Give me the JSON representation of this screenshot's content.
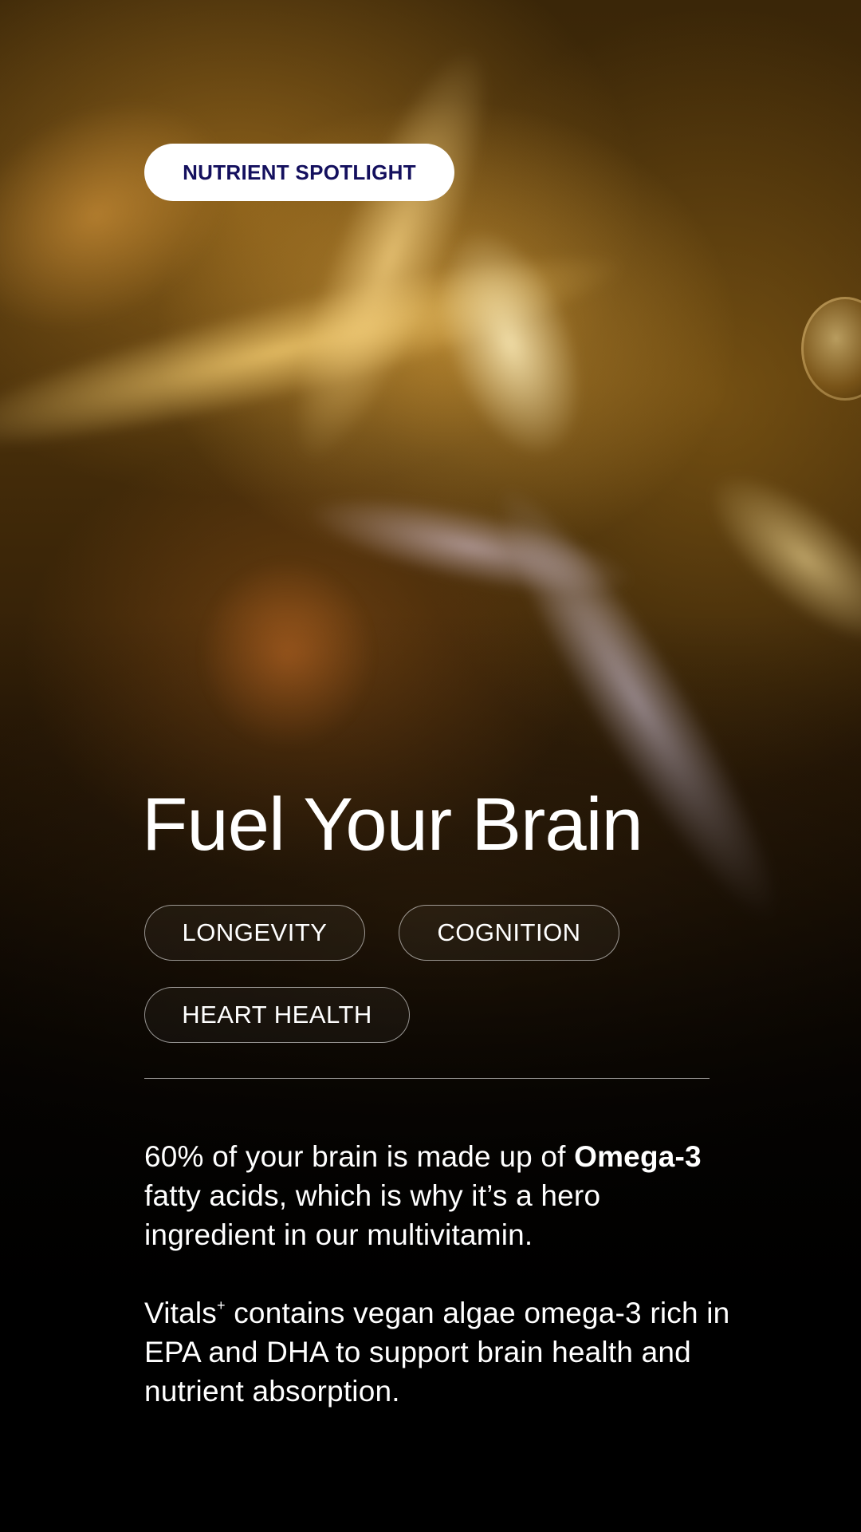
{
  "colors": {
    "badge_background": "#ffffff",
    "badge_text": "#14105e",
    "text": "#ffffff",
    "background_gold": "#c58a2a",
    "background_dark": "#000000"
  },
  "background": {
    "image_name": "golden-oil-droplets-image"
  },
  "badge": {
    "label": "NUTRIENT SPOTLIGHT"
  },
  "headline": {
    "title": "Fuel Your Brain"
  },
  "tags": [
    {
      "label": "LONGEVITY"
    },
    {
      "label": "COGNITION"
    },
    {
      "label": "HEART HEALTH"
    }
  ],
  "body": {
    "paragraph_1": {
      "before": "60% of your brain is made up of ",
      "bold": "Omega-3",
      "after": " fatty acids, which is why it’s a hero ingredient in our multivitamin."
    },
    "paragraph_2": {
      "brand": "Vitals",
      "superscript": "+",
      "after": " contains vegan algae omega-3 rich in EPA and DHA to support brain health and nutrient absorption."
    }
  }
}
